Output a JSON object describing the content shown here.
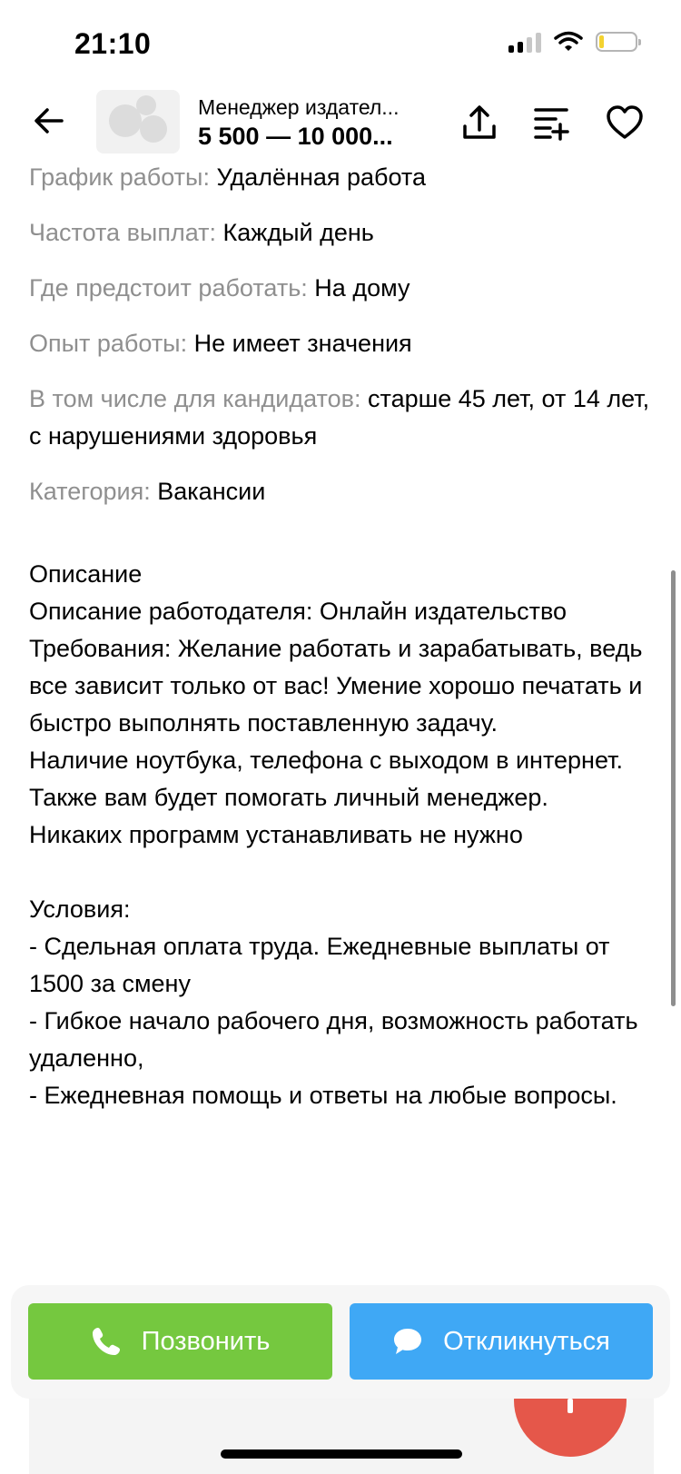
{
  "status_bar": {
    "time": "21:10"
  },
  "header": {
    "title": "Менеджер издател...",
    "price": "5 500 — 10 000..."
  },
  "params": [
    {
      "key": "График работы:",
      "value": "Удалённая работа"
    },
    {
      "key": "Частота выплат:",
      "value": "Каждый день"
    },
    {
      "key": "Где предстоит работать:",
      "value": "На дому"
    },
    {
      "key": "Опыт работы:",
      "value": "Не имеет значения"
    },
    {
      "key": "В том числе для кандидатов:",
      "value": "старше 45 лет, от 14 лет, с нарушениями здоровья"
    },
    {
      "key": "Категория:",
      "value": "Вакансии"
    }
  ],
  "description": {
    "lines": [
      "Описание",
      "Описание работодателя: Онлайн издательство",
      "Требования: Желание работать и зарабатывать, ведь все зависит только от вас! Умение хорошо печатать и быстро выполнять поставленную задачу.",
      "Наличие ноутбука, телефона с выходом в интернет.",
      "Также вам будет помогать личный менеджер.",
      "Никаких программ устанавливать не нужно",
      "",
      "Условия:",
      "- Сдельная оплата труда. Ежедневные выплаты от 1500 за смену",
      "- Гибкое начало рабочего дня, возможность работать удаленно,",
      "- Ежедневная помощь и ответы на любые вопросы."
    ]
  },
  "actions": {
    "call_label": "Позвонить",
    "reply_label": "Откликнуться"
  },
  "icons": {
    "back": "arrow-left-icon",
    "share": "share-icon",
    "compare": "list-add-icon",
    "favorite": "heart-icon",
    "phone": "phone-icon",
    "chat": "chat-bubble-icon"
  },
  "colors": {
    "call_button": "#75c83f",
    "reply_button": "#3fa8f5",
    "muted_text": "#8f8f8f"
  }
}
